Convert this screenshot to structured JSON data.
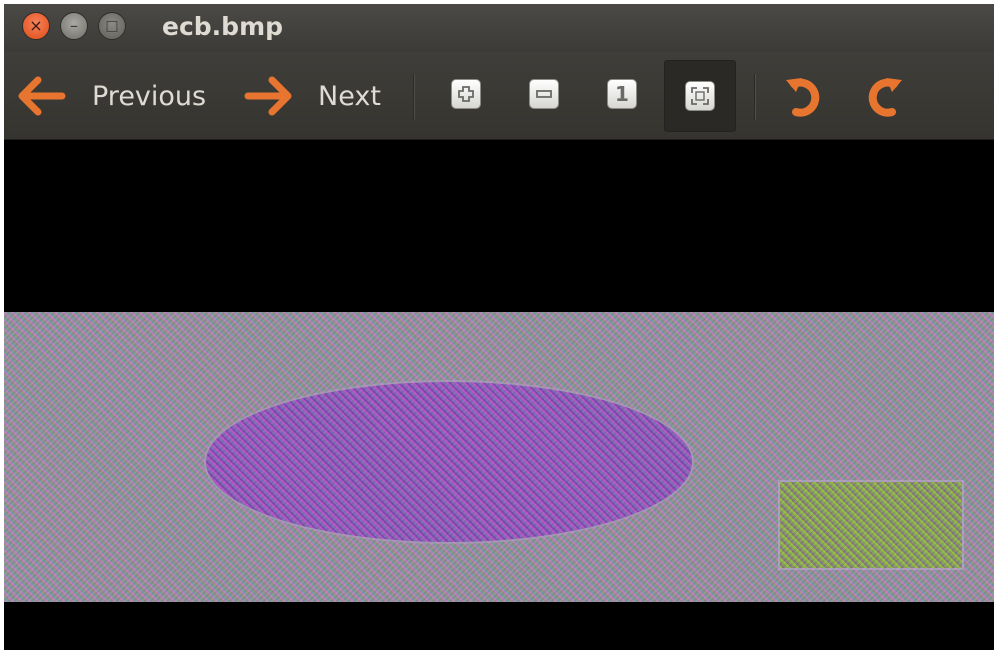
{
  "window": {
    "title": "ecb.bmp",
    "close_glyph": "×",
    "minimize_glyph": "–",
    "maximize_glyph": "□"
  },
  "toolbar": {
    "previous_label": "Previous",
    "next_label": "Next",
    "zoom_in_icon": "zoom-in-icon",
    "zoom_out_icon": "zoom-out-icon",
    "normal_size_glyph": "1",
    "best_fit_icon": "best-fit-icon",
    "rotate_left_icon": "rotate-left-icon",
    "rotate_right_icon": "rotate-right-icon",
    "best_fit_active": true
  },
  "colors": {
    "accent_orange": "#e8752f",
    "titlebar": "#3c3b37",
    "title_text": "#dfdbd2",
    "canvas_background": "#000000"
  },
  "image": {
    "description_shapes": [
      "ellipse",
      "rectangle"
    ]
  }
}
